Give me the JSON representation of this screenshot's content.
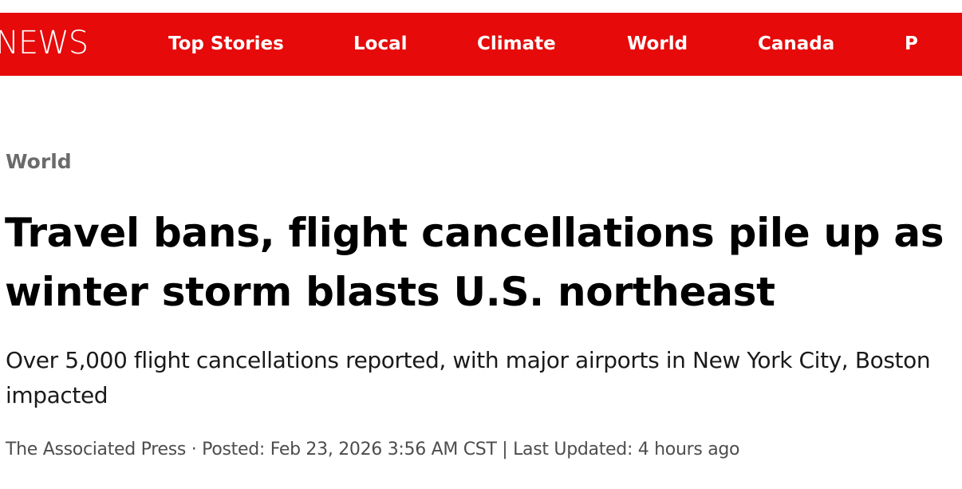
{
  "header": {
    "brand": "NEWS",
    "nav": [
      {
        "label": "Top Stories"
      },
      {
        "label": "Local"
      },
      {
        "label": "Climate"
      },
      {
        "label": "World"
      },
      {
        "label": "Canada"
      },
      {
        "label": "P"
      }
    ]
  },
  "article": {
    "section": "World",
    "headline": "Travel bans, flight cancellations pile up as winter storm blasts U.S. northeast",
    "deck": "Over 5,000 flight cancellations reported, with major airports in New York City, Boston impacted",
    "byline": {
      "author": "The Associated Press",
      "separator": " · ",
      "posted": "Posted: Feb 23, 2026 3:56 AM CST",
      "divider": " | ",
      "updated": "Last Updated: 4 hours ago"
    }
  },
  "colors": {
    "brand_red": "#e60a0a",
    "text": "#000000",
    "muted": "#6b6b6b"
  }
}
